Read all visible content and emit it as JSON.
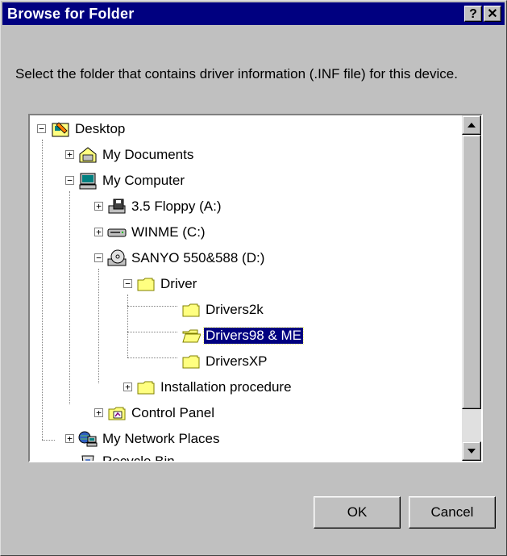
{
  "window": {
    "title": "Browse for Folder",
    "help_label": "?",
    "close_label": "✕"
  },
  "instruction": "Select the folder that contains driver information (.INF file) for this device.",
  "tree": {
    "items": [
      {
        "label": "Desktop",
        "expander": "−",
        "icon": "desktop-icon"
      },
      {
        "label": "My Documents",
        "expander": "+",
        "icon": "my-documents-icon"
      },
      {
        "label": "My Computer",
        "expander": "−",
        "icon": "my-computer-icon"
      },
      {
        "label": "3.5 Floppy (A:)",
        "expander": "+",
        "icon": "floppy-drive-icon"
      },
      {
        "label": "WINME (C:)",
        "expander": "+",
        "icon": "hard-drive-icon"
      },
      {
        "label": "SANYO 550&588 (D:)",
        "expander": "−",
        "icon": "cd-drive-icon"
      },
      {
        "label": "Driver",
        "expander": "−",
        "icon": "folder-icon"
      },
      {
        "label": "Drivers2k",
        "icon": "folder-icon"
      },
      {
        "label": "Drivers98 & ME",
        "icon": "open-folder-icon",
        "selected": true
      },
      {
        "label": "DriversXP",
        "icon": "folder-icon"
      },
      {
        "label": "Installation procedure",
        "expander": "+",
        "icon": "folder-icon"
      },
      {
        "label": "Control Panel",
        "expander": "+",
        "icon": "control-panel-icon"
      },
      {
        "label": "My Network Places",
        "expander": "+",
        "icon": "network-places-icon"
      },
      {
        "label": "Recycle Bin",
        "icon": "recycle-bin-icon"
      }
    ]
  },
  "buttons": {
    "ok": "OK",
    "cancel": "Cancel"
  },
  "colors": {
    "titlebar": "#000080",
    "face": "#c0c0c0",
    "selection": "#000080",
    "folder": "#ffff80"
  }
}
